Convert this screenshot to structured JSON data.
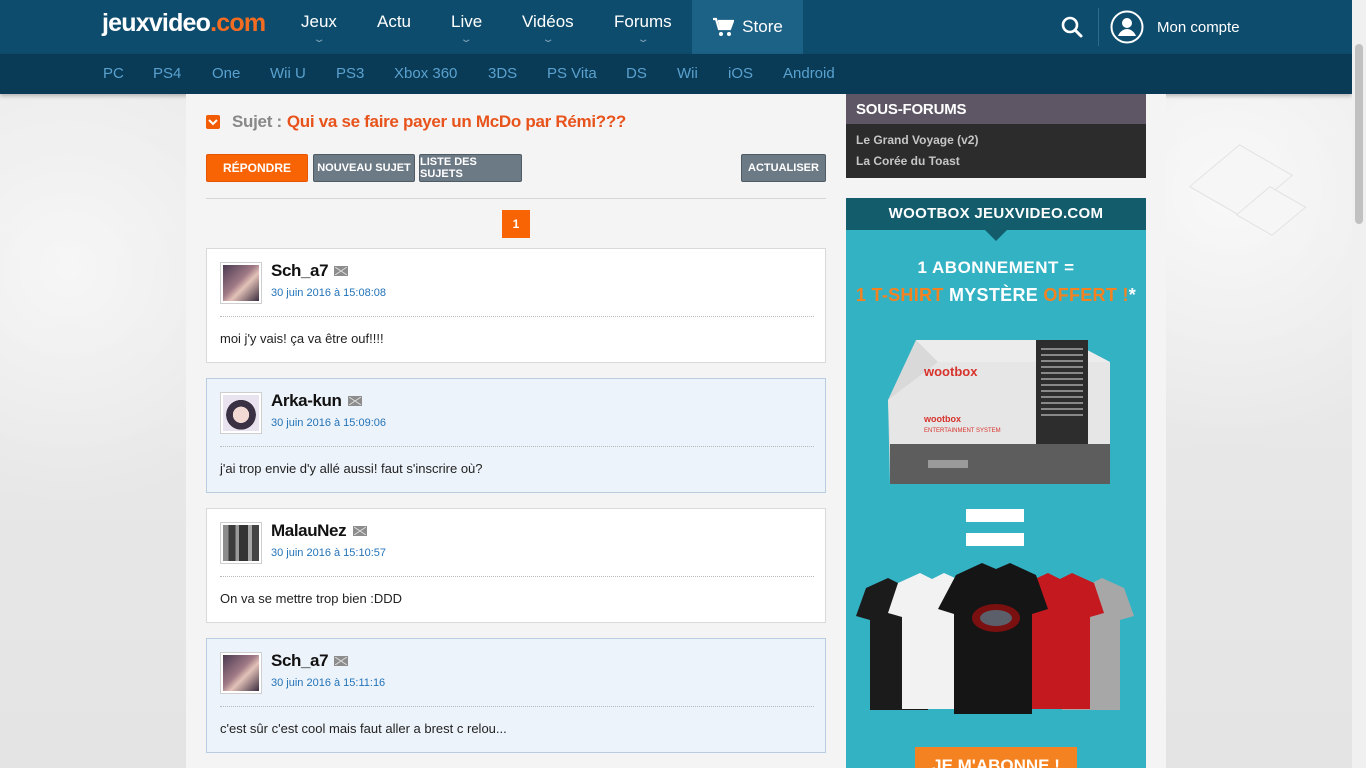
{
  "header": {
    "logo": "jeuxvideo",
    "logo_tld": ".com",
    "nav": [
      "Jeux",
      "Actu",
      "Live",
      "Vidéos",
      "Forums"
    ],
    "store_label": "Store",
    "account_label": "Mon compte",
    "platforms": [
      "PC",
      "PS4",
      "One",
      "Wii U",
      "PS3",
      "Xbox 360",
      "3DS",
      "PS Vita",
      "DS",
      "Wii",
      "iOS",
      "Android"
    ]
  },
  "topic": {
    "subject_label": "Sujet :",
    "title": "Qui va se faire payer un McDo par Rémi???",
    "reply_label": "RÉPONDRE",
    "new_topic_label": "NOUVEAU SUJET",
    "topic_list_label": "LISTE DES SUJETS",
    "refresh_label": "ACTUALISER",
    "page": "1"
  },
  "posts": [
    {
      "author": "Sch_a7",
      "date": "30 juin 2016 à 15:08:08",
      "message": "moi j'y vais! ça va être ouf!!!!"
    },
    {
      "author": "Arka-kun",
      "date": "30 juin 2016 à 15:09:06",
      "message": "j'ai trop envie d'y allé aussi! faut s'inscrire où?"
    },
    {
      "author": "MalauNez",
      "date": "30 juin 2016 à 15:10:57",
      "message": "On va se mettre trop bien :DDD"
    },
    {
      "author": "Sch_a7",
      "date": "30 juin 2016 à 15:11:16",
      "message": "c'est sûr c'est cool mais faut aller a brest c relou..."
    }
  ],
  "sidebar": {
    "subforums_title": "SOUS-FORUMS",
    "subforums": [
      "Le Grand Voyage (v2)",
      "La Corée du Toast"
    ]
  },
  "ad": {
    "header": "WOOTBOX JEUXVIDEO.COM",
    "line1": "1 ABONNEMENT =",
    "line2_a": "1 T-SHIRT",
    "line2_b": " MYSTÈRE ",
    "line2_c": "OFFERT !",
    "line2_d": "*",
    "console_brand": "wootbox",
    "console_sub": "ENTERTAINMENT SYSTEM",
    "cta": "JE M'ABONNE !"
  },
  "colors": {
    "header_bg": "#0e4c6d",
    "subbar_bg": "#093b56",
    "accent_orange": "#f86404",
    "link_blue": "#2373b8"
  }
}
